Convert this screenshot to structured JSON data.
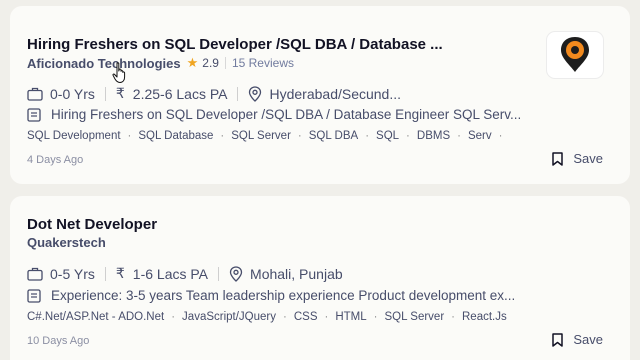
{
  "jobs": [
    {
      "title": "Hiring Freshers on SQL Developer /SQL DBA / Database ...",
      "company": "Aficionado Technologies",
      "rating": "2.9",
      "reviews": "15 Reviews",
      "experience": "0-0 Yrs",
      "salary": "2.25-6 Lacs PA",
      "location": "Hyderabad/Secund...",
      "description": "Hiring Freshers on SQL Developer /SQL DBA / Database Engineer SQL Serv...",
      "tags": [
        "SQL Development",
        "SQL Database",
        "SQL Server",
        "SQL DBA",
        "SQL",
        "DBMS",
        "Serv"
      ],
      "posted": "4 Days Ago",
      "save_label": "Save"
    },
    {
      "title": "Dot Net Developer",
      "company": "Quakerstech",
      "experience": "0-5 Yrs",
      "salary": "1-6 Lacs PA",
      "location": "Mohali, Punjab",
      "description": "Experience: 3-5 years Team leadership experience Product development ex...",
      "tags": [
        "C#.Net/ASP.Net - ADO.Net",
        "JavaScript/JQuery",
        "CSS",
        "HTML",
        "SQL Server",
        "React.Js"
      ],
      "posted": "10 Days Ago",
      "save_label": "Save"
    }
  ],
  "colors": {
    "background": "#f0efea",
    "card": "#fbfbf8",
    "title": "#121224",
    "text": "#474d6a",
    "star": "#f0a521",
    "logo_orange": "#f28a1e"
  },
  "icons": {
    "experience": "briefcase-icon",
    "salary": "rupee-icon",
    "location": "location-pin-icon",
    "description": "document-icon",
    "save": "bookmark-icon",
    "rating": "star-icon",
    "cursor": "hand-pointer-icon"
  }
}
